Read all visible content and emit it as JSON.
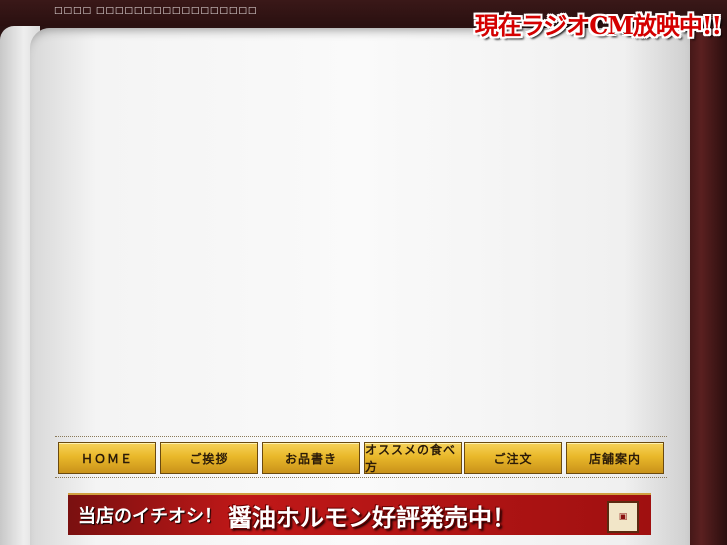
{
  "header": {
    "top_text": "□□□□ □□□□□□□□□□□□□□□□□",
    "radio_banner": "現在ラジオCM放映中!!"
  },
  "nav": {
    "items": [
      {
        "label": "ＨＯＭＥ"
      },
      {
        "label": "ご挨拶"
      },
      {
        "label": "お品書き"
      },
      {
        "label": "オススメの食べ方"
      },
      {
        "label": "ご注文"
      },
      {
        "label": "店舗案内"
      }
    ]
  },
  "promo": {
    "lead": "当店のイチオシ！",
    "main": "醤油ホルモン好評発売中！",
    "stamp_icon": "product-package-icon"
  },
  "colors": {
    "nav_gold": "#e9b82a",
    "promo_red": "#c01818",
    "frame_dark": "#2a1212"
  }
}
